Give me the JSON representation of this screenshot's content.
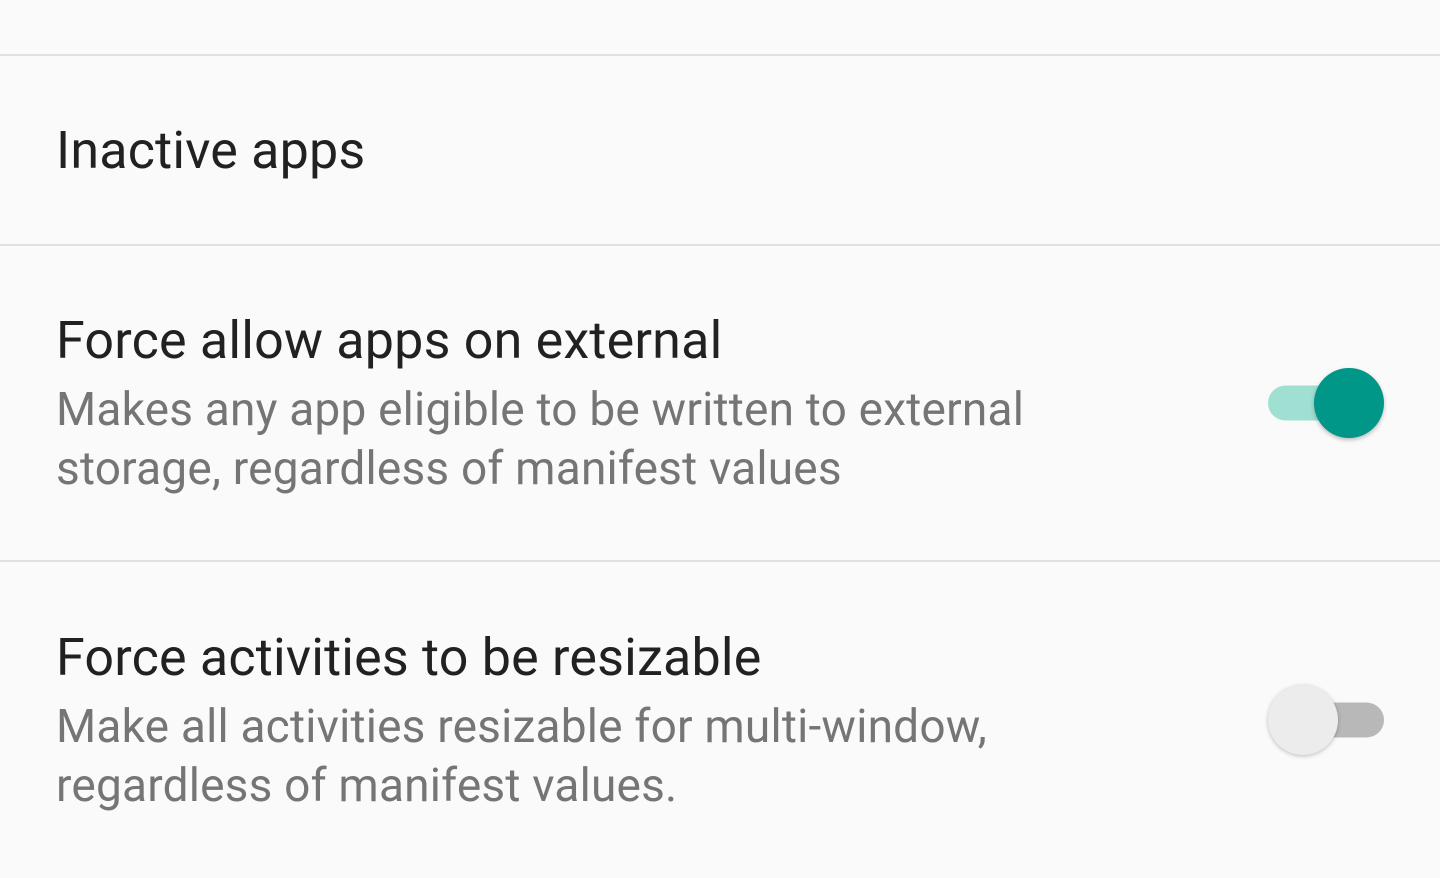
{
  "items": [
    {
      "title": "Inactive apps"
    },
    {
      "title": "Force allow apps on external",
      "desc": "Makes any app eligible to be written to external storage, regardless of manifest values",
      "toggle": true
    },
    {
      "title": "Force activities to be resizable",
      "desc": "Make all activities resizable for multi-window, regardless of manifest values.",
      "toggle": false
    }
  ],
  "colors": {
    "accent": "#009688",
    "accent_light": "#9fe0d3",
    "text_primary": "#212121",
    "text_secondary": "#757575"
  }
}
